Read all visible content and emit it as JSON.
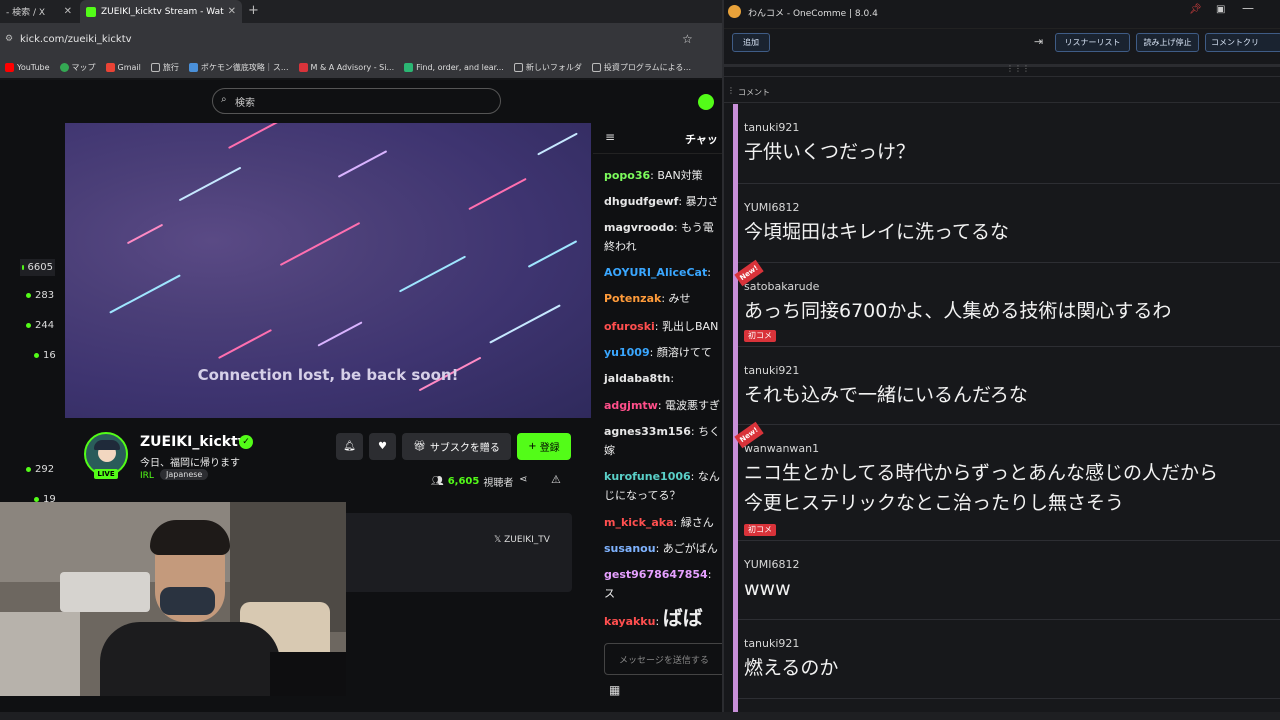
{
  "browser": {
    "tabs": [
      {
        "title": "- 検索 / X"
      },
      {
        "title": "ZUEIKI_kicktv Stream - Wat"
      }
    ],
    "url": "kick.com/zueiki_kicktv",
    "bookmarks": [
      "YouTube",
      "マップ",
      "Gmail",
      "旅行",
      "ポケモン徹底攻略｜ス...",
      "M & A Advisory - Si...",
      "Find, order, and lear...",
      "新しいフォルダ",
      "投資プログラムによる..."
    ]
  },
  "kick": {
    "search_placeholder": "検索",
    "video_message": "Connection lost, be back soon!",
    "sidebar_counts": [
      "6605",
      "283",
      "244",
      "16",
      "292",
      "19"
    ],
    "channel": {
      "name": "ZUEIKI_kicktv",
      "live": "LIVE",
      "title": "今日、福岡に帰ります",
      "category": "IRL",
      "language": "Japanese",
      "subscribe_label": "サブスクを贈る",
      "follow_label": "登録",
      "viewer_count": "6,605",
      "viewer_label": "視聴者",
      "x_link": "ZUEIKI_TV"
    },
    "chat": {
      "header": "チャッ",
      "input_placeholder": "メッセージを送信する",
      "messages": [
        {
          "user": "popo36",
          "text": "BAN対策",
          "color": "#7cfc5c"
        },
        {
          "user": "dhgudfgewf",
          "text": "暴力さ",
          "color": "#e6e6e6"
        },
        {
          "user": "magvroodo",
          "text": "もう電",
          "text2": "終われ",
          "color": "#e6e6e6"
        },
        {
          "user": "AOYURI_AliceCat",
          "text": "",
          "color": "#3aa7ff"
        },
        {
          "user": "Potenzak",
          "text": "みせ",
          "color": "#ff9b3a"
        },
        {
          "user": "ofuroski",
          "text": "乳出しBAN",
          "color": "#ff4f4f"
        },
        {
          "user": "yu1009",
          "text": "顔溶けてて",
          "color": "#3aa7ff"
        },
        {
          "user": "jaldaba8th",
          "text": "",
          "color": "#e6e6e6"
        },
        {
          "user": "adgjmtw",
          "text": "電波悪すぎ",
          "color": "#ff4f8a"
        },
        {
          "user": "agnes33m156",
          "text": "ちく",
          "text2": "嫁",
          "color": "#e6e6e6"
        },
        {
          "user": "kurofune1006",
          "text": "なん",
          "text2": "じになってる？",
          "color": "#5ad0c8"
        },
        {
          "user": "m_kick_aka",
          "text": "緑さん",
          "color": "#ff4f4f"
        },
        {
          "user": "susanou",
          "text": "あごがばん",
          "color": "#7fb3ff"
        },
        {
          "user": "gest9678647854",
          "text": "",
          "text2": "ス",
          "color": "#e6a0ff"
        },
        {
          "user": "kayakku",
          "text": "ばば",
          "color": "#ff4f4f"
        }
      ]
    }
  },
  "onecomme": {
    "title": "わんコメ - OneComme | 8.0.4",
    "add_label": "追加",
    "listener_label": "リスナーリスト",
    "reading_label": "読み上げ停止",
    "comment_clear_label": "コメントクリ",
    "comment_section": "コメント",
    "first_badge": "初コメ",
    "new_badge": "New!",
    "comments": [
      {
        "user": "tanuki921",
        "text": "子供いくつだっけ？"
      },
      {
        "user": "YUMI6812",
        "text": "今頃堀田はキレイに洗ってるな"
      },
      {
        "user": "satobakarude",
        "text": "あっち同接6700かよ、人集める技術は関心するわ",
        "first": true,
        "new": true
      },
      {
        "user": "tanuki921",
        "text": "それも込みで一緒にいるんだろな"
      },
      {
        "user": "wanwanwan1",
        "text": "ニコ生とかしてる時代からずっとあんな感じの人だから",
        "text2": "今更ヒステリックなとこ治ったりし無さそう",
        "first": true,
        "new": true
      },
      {
        "user": "YUMI6812",
        "text": "www"
      },
      {
        "user": "tanuki921",
        "text": "燃えるのか"
      }
    ]
  }
}
